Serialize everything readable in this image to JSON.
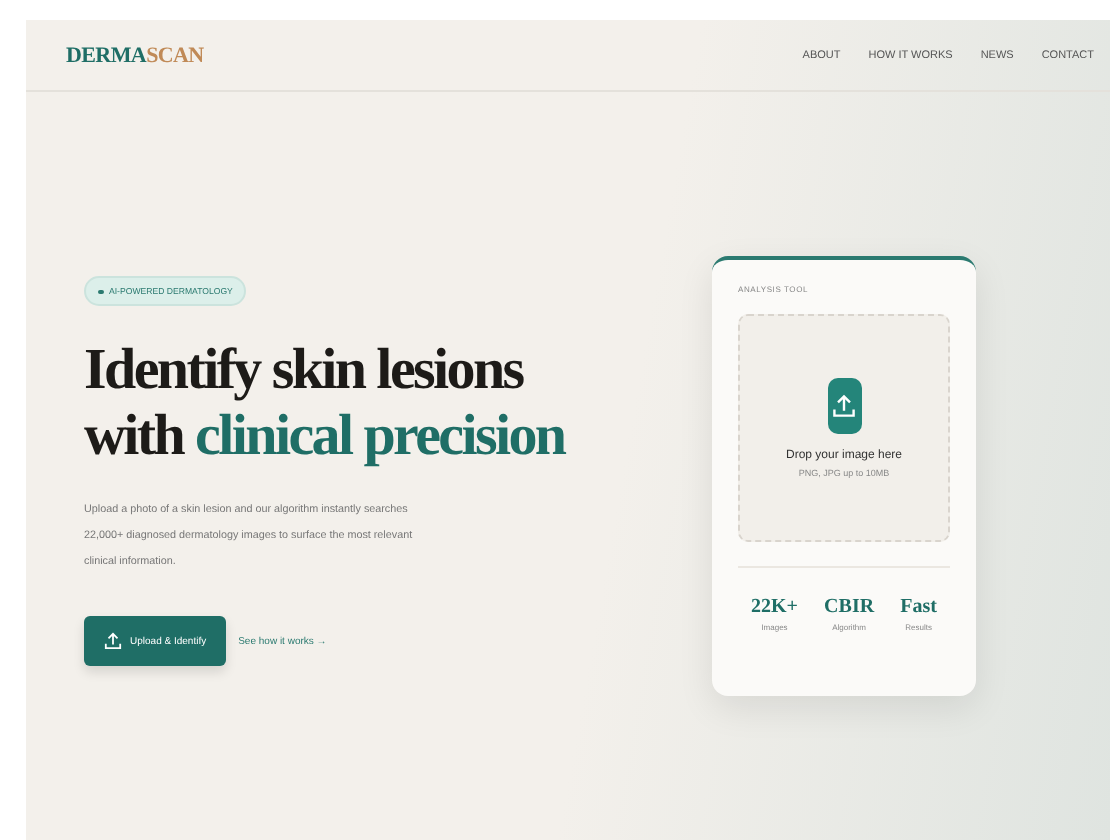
{
  "header": {
    "logo_primary": "DERMA",
    "logo_accent": "SCAN",
    "nav": [
      "ABOUT",
      "HOW IT WORKS",
      "NEWS",
      "CONTACT"
    ]
  },
  "hero": {
    "badge": "AI-POWERED DERMATOLOGY",
    "heading_line1": "Identify skin lesions",
    "heading_lead": "with",
    "heading_accent": "clinical precision",
    "description": "Upload a photo of a skin lesion and our algorithm instantly searches 22,000+ diagnosed dermatology images to surface the most relevant clinical information.",
    "primary_button": "Upload & Identify",
    "secondary_link": "See how it works →"
  },
  "card": {
    "label": "ANALYSIS TOOL",
    "drop_title": "Drop your image here",
    "drop_hint": "PNG, JPG up to 10MB",
    "stats": [
      {
        "value": "22K+",
        "caption": "Images"
      },
      {
        "value": "CBIR",
        "caption": "Algorithm"
      },
      {
        "value": "Fast",
        "caption": "Results"
      }
    ]
  }
}
